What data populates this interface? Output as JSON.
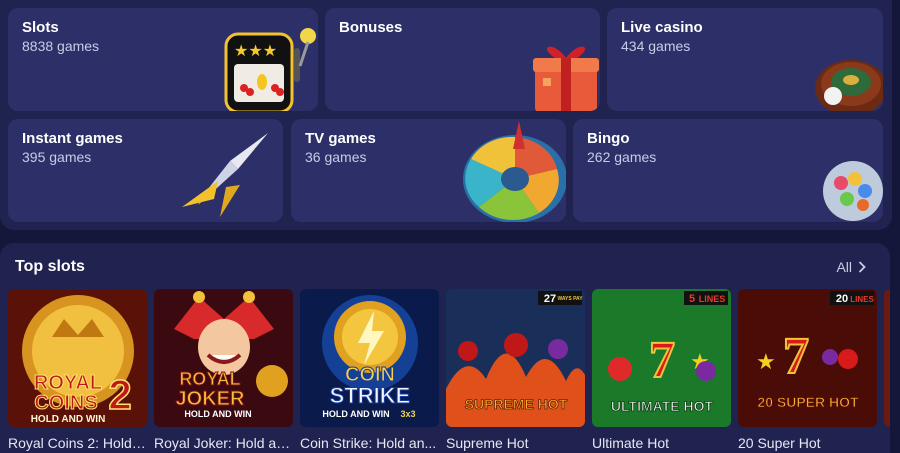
{
  "categories": [
    {
      "title": "Slots",
      "count": "8838 games",
      "icon": "slot-machine-icon"
    },
    {
      "title": "Bonuses",
      "count": "",
      "icon": "gift-box-icon"
    },
    {
      "title": "Live casino",
      "count": "434 games",
      "icon": "roulette-icon"
    },
    {
      "title": "Instant games",
      "count": "395 games",
      "icon": "rocket-plane-icon"
    },
    {
      "title": "TV games",
      "count": "36 games",
      "icon": "fortune-wheel-icon"
    },
    {
      "title": "Bingo",
      "count": "262 games",
      "icon": "bingo-balls-icon"
    }
  ],
  "top_slots": {
    "title": "Top slots",
    "all_label": "All",
    "games": [
      {
        "name": "Royal Coins 2: Hold ...",
        "logo_line1": "ROYAL",
        "logo_line2": "COINS",
        "logo_num": "2",
        "logo_sub": "HOLD AND WIN"
      },
      {
        "name": "Royal Joker: Hold an...",
        "logo_line1": "ROYAL",
        "logo_line2": "JOKER",
        "logo_sub": "HOLD AND WIN"
      },
      {
        "name": "Coin Strike: Hold an...",
        "logo_line1": "COIN",
        "logo_line2": "STRIKE",
        "logo_sub": "HOLD AND WIN",
        "logo_badge": "3x3"
      },
      {
        "name": "Supreme Hot",
        "logo_line1": "SUPREME HOT",
        "badge_num": "27",
        "badge_text": "WAYS PAY"
      },
      {
        "name": "Ultimate Hot",
        "logo_line1": "ULTIMATE HOT",
        "badge_num": "5",
        "badge_text": "LINES"
      },
      {
        "name": "20 Super Hot",
        "logo_line1": "20 SUPER HOT",
        "badge_num": "20",
        "badge_text": "LINES"
      }
    ]
  },
  "colors": {
    "background": "#14163a",
    "panel": "#20234f",
    "tile": "#2d3068",
    "text_muted": "#c9cbe6"
  }
}
